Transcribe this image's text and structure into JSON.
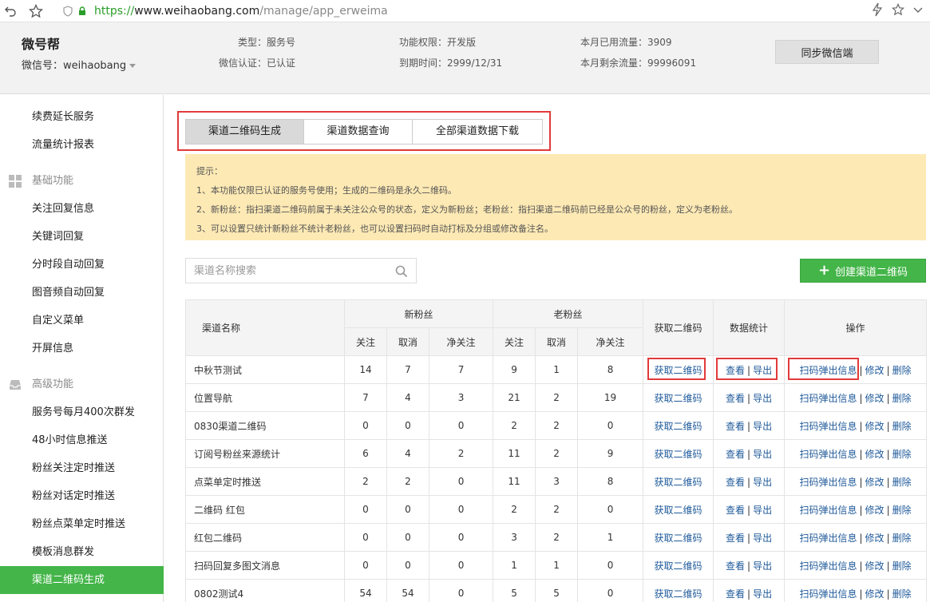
{
  "browser": {
    "protocol": "https://",
    "host": "www.weihaobang.com",
    "path": "/manage/app_erweima"
  },
  "header": {
    "account_name": "微号帮",
    "account_id": "微信号：weihaobang",
    "type": "类型：服务号",
    "verified": "微信认证：已认证",
    "permission": "功能权限：开发版",
    "expire": "到期时间：2999/12/31",
    "traffic_used": "本月已用流量：3909",
    "traffic_left": "本月剩余流量：99996091",
    "sync_button": "同步微信端"
  },
  "sidebar": {
    "top_items": [
      "续费延长服务",
      "流量统计报表"
    ],
    "section_basic": "基础功能",
    "basic_items": [
      "关注回复信息",
      "关键词回复",
      "分时段自动回复",
      "图音频自动回复",
      "自定义菜单",
      "开屏信息"
    ],
    "section_advanced": "高级功能",
    "advanced_items": [
      "服务号每月400次群发",
      "48小时信息推送",
      "粉丝关注定时推送",
      "粉丝对话定时推送",
      "粉丝点菜单定时推送",
      "模板消息群发",
      "渠道二维码生成"
    ]
  },
  "tabs": [
    "渠道二维码生成",
    "渠道数据查询",
    "全部渠道数据下载"
  ],
  "notice": {
    "title": "提示：",
    "lines": [
      "1、本功能仅限已认证的服务号使用；生成的二维码是永久二维码。",
      "2、新粉丝：指扫渠道二维码前属于未关注公众号的状态，定义为新粉丝；老粉丝：指扫渠道二维码前已经是公众号的粉丝，定义为老粉丝。",
      "3、可以设置只统计新粉丝不统计老粉丝，也可以设置扫码时自动打标及分组或修改备注名。"
    ]
  },
  "search": {
    "placeholder": "渠道名称搜索"
  },
  "create_button": "创建渠道二维码",
  "table": {
    "headers": {
      "name": "渠道名称",
      "new_fans": "新粉丝",
      "old_fans": "老粉丝",
      "get_qr": "获取二维码",
      "stats": "数据统计",
      "ops": "操作",
      "follow": "关注",
      "cancel": "取消",
      "net": "净关注"
    },
    "links": {
      "get_qr": "获取二维码",
      "view": "查看",
      "export": "导出",
      "popup": "扫码弹出信息",
      "edit": "修改",
      "delete": "删除"
    },
    "rows": [
      {
        "name": "中秋节测试",
        "nf": [
          "14",
          "7",
          "7"
        ],
        "of": [
          "9",
          "1",
          "8"
        ]
      },
      {
        "name": "位置导航",
        "nf": [
          "7",
          "4",
          "3"
        ],
        "of": [
          "21",
          "2",
          "19"
        ]
      },
      {
        "name": "0830渠道二维码",
        "nf": [
          "0",
          "0",
          "0"
        ],
        "of": [
          "2",
          "2",
          "0"
        ]
      },
      {
        "name": "订阅号粉丝来源统计",
        "nf": [
          "6",
          "4",
          "2"
        ],
        "of": [
          "11",
          "2",
          "9"
        ]
      },
      {
        "name": "点菜单定时推送",
        "nf": [
          "2",
          "2",
          "0"
        ],
        "of": [
          "11",
          "3",
          "8"
        ]
      },
      {
        "name": "二维码 红包",
        "nf": [
          "0",
          "0",
          "0"
        ],
        "of": [
          "2",
          "2",
          "0"
        ]
      },
      {
        "name": "红包二维码",
        "nf": [
          "0",
          "0",
          "0"
        ],
        "of": [
          "3",
          "2",
          "1"
        ]
      },
      {
        "name": "扫码回复多图文消息",
        "nf": [
          "0",
          "0",
          "0"
        ],
        "of": [
          "1",
          "1",
          "0"
        ]
      },
      {
        "name": "0802测试4",
        "nf": [
          "54",
          "54",
          "0"
        ],
        "of": [
          "5",
          "5",
          "0"
        ]
      }
    ]
  },
  "colors": {
    "accent_green": "#44b549",
    "highlight_red": "#e23a3a",
    "link_blue": "#1f5a9a",
    "notice_bg": "#fde9b4"
  }
}
